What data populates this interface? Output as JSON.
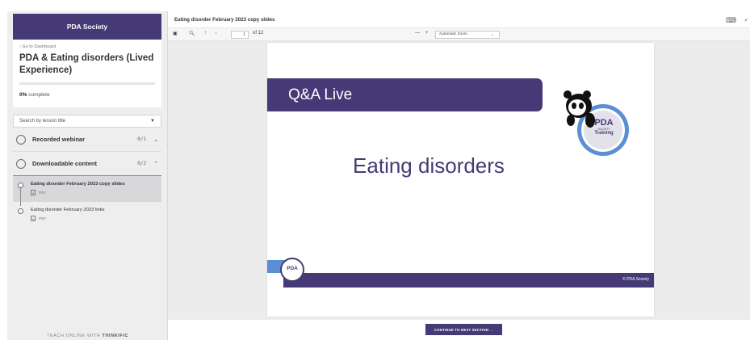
{
  "school": {
    "name": "PDA Society"
  },
  "course": {
    "back_link": "‹ Go to Dashboard",
    "title": "PDA & Eating disorders (Lived Experience)",
    "progress_percent": 0,
    "progress_value": "0%",
    "progress_suffix": " complete"
  },
  "search": {
    "placeholder": "Search by lesson title"
  },
  "chapters": [
    {
      "title": "Recorded webinar",
      "count": "0/1",
      "expanded": false
    },
    {
      "title": "Downloadable content",
      "count": "0/2",
      "expanded": true,
      "lessons": [
        {
          "title": "Eating disorder February 2023 copy slides",
          "type": "PDF",
          "active": true
        },
        {
          "title": "Eating disorder February 2023 links",
          "type": "PDF",
          "active": false
        }
      ]
    }
  ],
  "footer": {
    "prefix": "TEACH ONLINE WITH ",
    "brand": "THINKIFIC"
  },
  "viewer": {
    "doc_title": "Eating disorder February 2023 copy slides",
    "page_number": "1",
    "page_total": "of 12",
    "zoom": "Automatic Zoom",
    "continue_label": "CONTINUE TO NEXT SECTION →"
  },
  "slide": {
    "banner": "Q&A Live",
    "title": "Eating disorders",
    "logo_text": "PDA",
    "logo_sub1": "SOCIETY",
    "logo_sub2": "Training",
    "footer_logo": "PDA",
    "copyright": "© PDA Society"
  },
  "colors": {
    "brand": "#463a76",
    "accent_blue": "#5b8fd4"
  }
}
